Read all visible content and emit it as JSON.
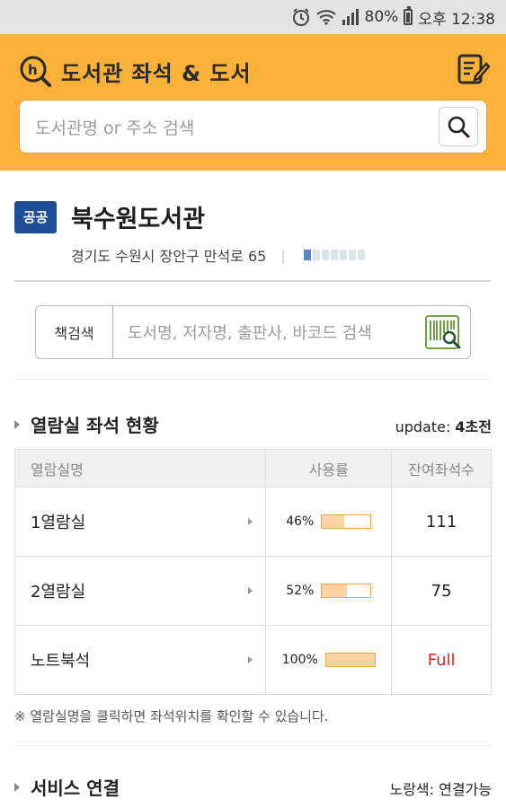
{
  "status_bar": {
    "battery_percent": "80%",
    "time": "오후 12:38"
  },
  "header": {
    "app_title": "도서관 좌석 & 도서",
    "search_placeholder": "도서관명 or 주소 검색"
  },
  "library": {
    "badge": "공공",
    "name": "북수원도서관",
    "address": "경기도 수원시 장안구 만석로 65",
    "address_separator": "|"
  },
  "book_search": {
    "label": "책검색",
    "placeholder": "도서명, 저자명, 출판사, 바코드 검색"
  },
  "reading_rooms": {
    "title": "열람실 좌석 현황",
    "update_label": "update:",
    "update_value": "4초전",
    "columns": [
      "열람실명",
      "사용률",
      "잔여좌석수"
    ],
    "rows": [
      {
        "name": "1열람실",
        "usage": "46%",
        "usage_fraction": 0.46,
        "remaining": "111",
        "full": false
      },
      {
        "name": "2열람실",
        "usage": "52%",
        "usage_fraction": 0.52,
        "remaining": "75",
        "full": false
      },
      {
        "name": "노트북석",
        "usage": "100%",
        "usage_fraction": 1.0,
        "remaining": "Full",
        "full": true
      }
    ],
    "note": "※ 열람실명을 클릭하면 좌석위치를 확인할 수 있습니다."
  },
  "services": {
    "title": "서비스 연결",
    "status_text": "노랑색: 연결가능"
  },
  "colors": {
    "header_bg": "#f9b13a",
    "badge_bg": "#1f4e98",
    "full_text": "#e02020",
    "usage_bar_fill": "#fbd2a4"
  }
}
